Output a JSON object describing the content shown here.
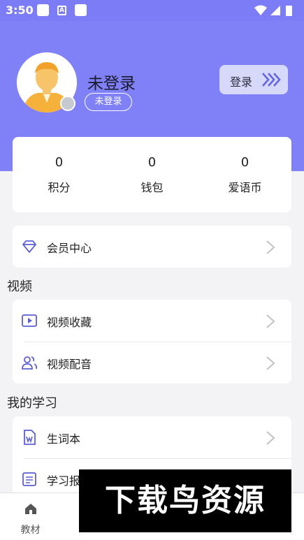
{
  "status_bar": {
    "time": "3:50",
    "icons": [
      "app-square-icon",
      "a-notification-icon",
      "app-square-icon",
      "wifi-icon",
      "signal-icon",
      "battery-icon"
    ]
  },
  "profile": {
    "name": "未登录",
    "tag": "未登录",
    "login_label": "登录"
  },
  "stats": [
    {
      "value": "0",
      "label": "积分"
    },
    {
      "value": "0",
      "label": "钱包"
    },
    {
      "value": "0",
      "label": "爱语币"
    }
  ],
  "membership": {
    "label": "会员中心"
  },
  "video_section": {
    "title": "视频",
    "items": [
      {
        "label": "视频收藏"
      },
      {
        "label": "视频配音"
      }
    ]
  },
  "study_section": {
    "title": "我的学习",
    "items": [
      {
        "label": "生词本"
      },
      {
        "label": "学习报"
      }
    ]
  },
  "tabbar": {
    "tabs": [
      {
        "label": "教材"
      }
    ]
  },
  "watermark": {
    "text": "下载鸟资源"
  },
  "colors": {
    "header": "#8081f7",
    "accent": "#5b5fd6",
    "background": "#f3f3f6"
  }
}
